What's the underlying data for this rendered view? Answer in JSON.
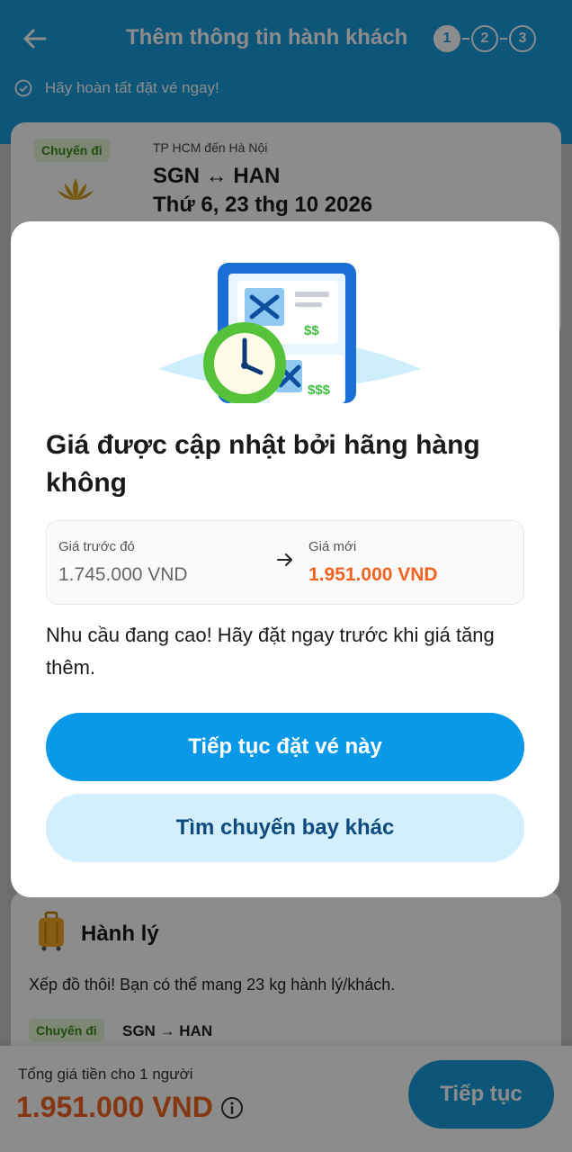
{
  "header": {
    "title": "Thêm thông tin hành khách",
    "steps": [
      "1",
      "2",
      "3"
    ],
    "notice": "Hãy hoàn tất đặt vé ngay!"
  },
  "flight_card": {
    "tag": "Chuyến đi",
    "route_small": "TP HCM đến Hà Nội",
    "route": "SGN ↔ HAN",
    "date": "Thứ 6, 23 thg 10 2026"
  },
  "baggage": {
    "title": "Hành lý",
    "description": "Xếp đồ thôi! Bạn có thể mang 23 kg hành lý/khách.",
    "tag": "Chuyến đi",
    "route": "SGN → HAN"
  },
  "footer": {
    "total_label": "Tổng giá tiền cho 1 người",
    "total_price": "1.951.000 VND",
    "continue_label": "Tiếp tục"
  },
  "modal": {
    "title": "Giá được cập nhật bởi hãng hàng không",
    "previous_label": "Giá trước đó",
    "previous_price": "1.745.000 VND",
    "new_label": "Giá mới",
    "new_price": "1.951.000 VND",
    "description": "Nhu cầu đang cao! Hãy đặt ngay trước khi giá tăng thêm.",
    "primary_button": "Tiếp tục đặt vé này",
    "secondary_button": "Tìm chuyến bay khác",
    "illustration_price_small": "$$",
    "illustration_price_large": "$$$"
  },
  "colors": {
    "brand_blue": "#1a9bde",
    "price_orange": "#f26322",
    "tag_green": "#3d8c1a"
  }
}
